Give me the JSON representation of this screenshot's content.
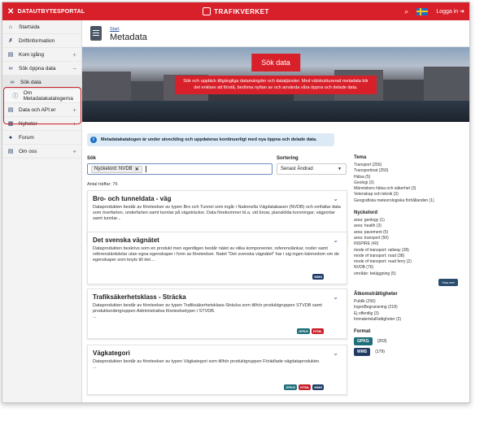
{
  "topbar": {
    "portal": "DATAUTBYTESPORTAL",
    "brand": "TRAFIKVERKET",
    "login": "Logga in"
  },
  "sidebar": {
    "items": [
      {
        "label": "Startsida",
        "icon": "home-icon"
      },
      {
        "label": "Driftinformation",
        "icon": "tools-icon"
      },
      {
        "label": "Kom igång",
        "icon": "book-icon"
      },
      {
        "label": "Sök öppna data",
        "icon": "binoculars-icon"
      },
      {
        "label": "Sök data",
        "icon": "binoculars-icon"
      },
      {
        "label": "Om Metadatakatalogerna",
        "icon": "info-icon"
      },
      {
        "label": "Data och API:er",
        "icon": "book-icon"
      },
      {
        "label": "Nyheter",
        "icon": "news-icon"
      },
      {
        "label": "Forum",
        "icon": "chat-icon"
      },
      {
        "label": "Om oss",
        "icon": "book-icon"
      }
    ]
  },
  "header": {
    "breadcrumb": "Start",
    "title": "Metadata"
  },
  "hero": {
    "title": "Sök data",
    "text": "Sök och upptäck tillgängliga datamängder och datatjänster. Med välstrukturerad metadata blir det enklare att förstå, bedöma nyttan av och använda våra öppna och delade data."
  },
  "info": "Metadatakatalogen är under utveckling och uppdateras kontinuerligt med nya öppna och delade data.",
  "search": {
    "label": "Sök",
    "chip": "Nyckelord: NVDB",
    "sort_label": "Sortering",
    "sort_value": "Senast Ändrad",
    "hits": "Antal träffar: 76"
  },
  "results": [
    {
      "title": "Bro- och tunneldata - väg",
      "desc": "Dataprodukten består av företeelser av typen Bro och Tunnel som ingår i Nationella Vägdatabasen (NVDB) och omfattar data som överfarten, underfarten samt tunnlar på vägsträckor. Data förekommer bl.a. vid broar, planskilda korsningar, vägportar samt tunnlar..."
    },
    {
      "title": "Det svenska vägnätet",
      "desc": "Dataprodukten beskrivs som en produkt men egentligen består nätet av olika komponenter, referenslänkar, noder samt referenslänkdelar utan egna egenskaper i form av företeelser. Natet \"Det svenska vägnätet\" har i sig ingen kännedom om de egenskaper som knyts till det...."
    },
    {
      "title": "Trafiksäkerhetsklass - Sträcka",
      "desc": "Dataprodukten består av företeelser av typen Trafiksäkerhetsklass-Sträcka som tillhör produktgruppen STVDB samt produktundergruppen Administrativa företeelsetyper i STVDB."
    },
    {
      "title": "Vägkategori",
      "desc": "Dataprodukten består av företeelser av typen Vägkategori som tillhör produktgruppen Förädlade vägdataprodukter."
    }
  ],
  "ellipsis": "...",
  "tags": {
    "wms": "WMS",
    "gpkg": "GPKG",
    "html": "HTML"
  },
  "facets": {
    "tema_title": "Tema",
    "tema": [
      "Transport (256)",
      "Transportinat (250)",
      "Hälsa (5)",
      "Geologi (3)",
      "Människors hälsa och säkerhet (3)",
      "Vetenskap och teknik (3)",
      "Geografiska meteorologiska förhållanden (1)"
    ],
    "nyckelord_title": "Nyckelord",
    "nyckelord": [
      "area: geology (1)",
      "area: health (3)",
      "area: pavement (5)",
      "area: transport (50)",
      "INSPIRE (40)",
      "mode of transport: railway (28)",
      "mode of transport: road (38)",
      "mode of transport: road ferry (2)",
      "NVDB (76)",
      "område: beläggning (5)"
    ],
    "showmore": "Visa mer",
    "atkomst_title": "Åtkomsträttigheter",
    "atkomst": [
      "Publik (256)",
      "IngenBegransning (218)",
      "Ej offentlig (3)",
      "ImmaterielaRattigheter (2)"
    ],
    "format_title": "Format",
    "format": [
      {
        "name": "GPKG",
        "count": "(203)",
        "color": "#1f6f7a"
      },
      {
        "name": "WMS",
        "count": "(179)",
        "color": "#1f3b66"
      }
    ]
  }
}
